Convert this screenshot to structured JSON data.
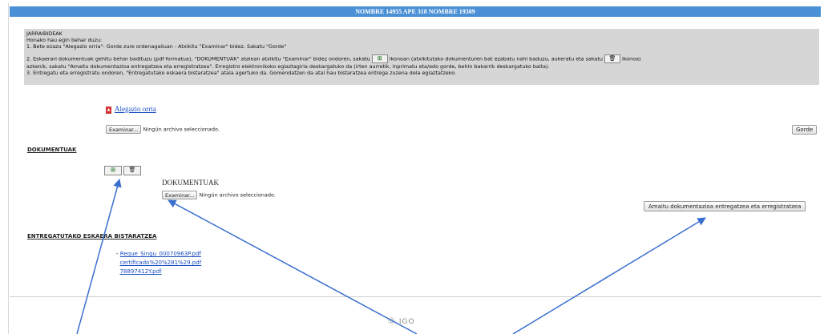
{
  "header": {
    "title": "NOMBRE 14955 APE 318 NOMBRE 19309"
  },
  "instructions": {
    "title": "JARRAIBIDEAK",
    "intro": "Honako hau egin behar duzu:",
    "step1": "1. Bete ezazu \"Alegazio orria\"- Gorde zure ordenagailuan - Atxikitu \"Examinar\" bidez. Sakatu \"Gorde\"",
    "step2a": "2. Eskaerari dokumentuak gehitu behar badituzu (pdf formatua), \"DOKUMENTUAK\" atalean atxikitu \"Examinar\" bidez ondoren, sakatu",
    "step2b": "ikonoan (atxikitutako dokumenturen bat ezabatu nahi baduzu, aukeratu eta sakatu",
    "step2c": "ikonoa)",
    "step2d": "azkenik, sakatu \"Amaitu dokumentazioa entregatzea eta erregistratzea\". Erregistro elektronikoko egiaztagiria deskargatuko da (irten aurretik, inprimatu eta/edo gorde, behin bakarrik deskargatuko baita).",
    "step3": "3. Entregatu eta erregistratu ondoren, \"Entregatutako eskaera bistaratzea\" atala agertuko da. Gomendatzen da atal hau bistaratzea entrega zuzena dela egiaztatzeko."
  },
  "alegazio": {
    "link": "Alegazio orria"
  },
  "file_input": {
    "button": "Examinar...",
    "status": "Ningún archivo seleccionado."
  },
  "gorde_button": "Gorde",
  "dokumentuak": {
    "section_title": "DOKUMENTUAK",
    "label": "DOKUMENTUAK",
    "button": "Examinar...",
    "status": "Ningún archivo seleccionado."
  },
  "amaitu_button": "Amaitu dokumentazioa entregatzea eta erregistratzea",
  "entregatutako": {
    "section_title": "ENTREGATUTAKO ESKAERA BISTARATZEA",
    "files": [
      "Reque_Singu_00070963P.pdf",
      "certificado%20%281%29.pdf",
      "78897412Y.pdf"
    ]
  },
  "footer": {
    "logo": "IGO"
  },
  "colors": {
    "header_bg": "#4a90d6",
    "instructions_bg": "#d6d6d6",
    "link": "#1a4fc0",
    "arrow": "#3b6fcf"
  },
  "icons": {
    "add": "add-document-icon",
    "delete": "trash-icon",
    "pdf": "pdf-icon"
  }
}
